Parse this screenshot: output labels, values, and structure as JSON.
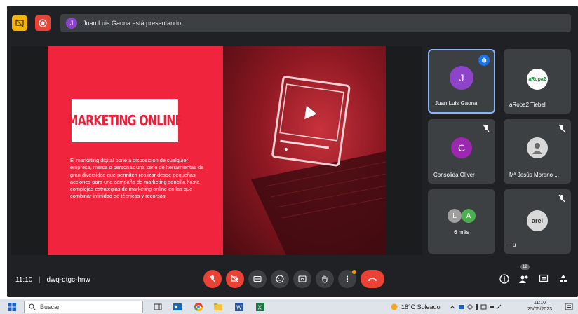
{
  "presentation_banner": {
    "avatar_letter": "J",
    "text": "Juan Luis Gaona está presentando"
  },
  "slide": {
    "title": "MARKETING ONLINE",
    "body": "El marketing digital pone a disposición de cualquier empresa, marca o personas una serie de herramientas de gran diversidad que permiten realizar desde pequeñas acciones para una campaña de marketing sencilla hasta complejas estrategias de marketing online en las que combinar infinidad de técnicas y recursos."
  },
  "participants": [
    {
      "name": "Juan Luis Gaona",
      "avatar": "J",
      "color": "#8e44c9",
      "speaking": true
    },
    {
      "name": "aRopa2 Tiebel",
      "avatar": "aRopa2",
      "color": "#ffffff",
      "speaking": false
    },
    {
      "name": "Consolida Oliver",
      "avatar": "C",
      "color": "#9c27b0",
      "speaking": false
    },
    {
      "name": "Mª Jesús Moreno ...",
      "avatar": "photo",
      "color": "#cfcfcf",
      "speaking": false
    },
    {
      "name": "6 más",
      "avatar_l": "L",
      "avatar_a": "A",
      "color_l": "#9e9e9e",
      "color_a": "#4caf50"
    },
    {
      "name": "Tú",
      "avatar": "arei",
      "color": "#d9d9d9"
    }
  ],
  "meeting": {
    "time": "11:10",
    "code": "dwq-qtgc-hnw",
    "participant_count": "12"
  },
  "taskbar": {
    "search_placeholder": "Buscar",
    "weather": "18°C Soleado",
    "clock_time": "11:10",
    "clock_date": "25/05/2023"
  },
  "colors": {
    "meet_bg": "#202124",
    "tile_bg": "#3c4043",
    "accent_red": "#ea4335",
    "slide_red": "#f0243d",
    "active_border": "#8ab4f8"
  }
}
